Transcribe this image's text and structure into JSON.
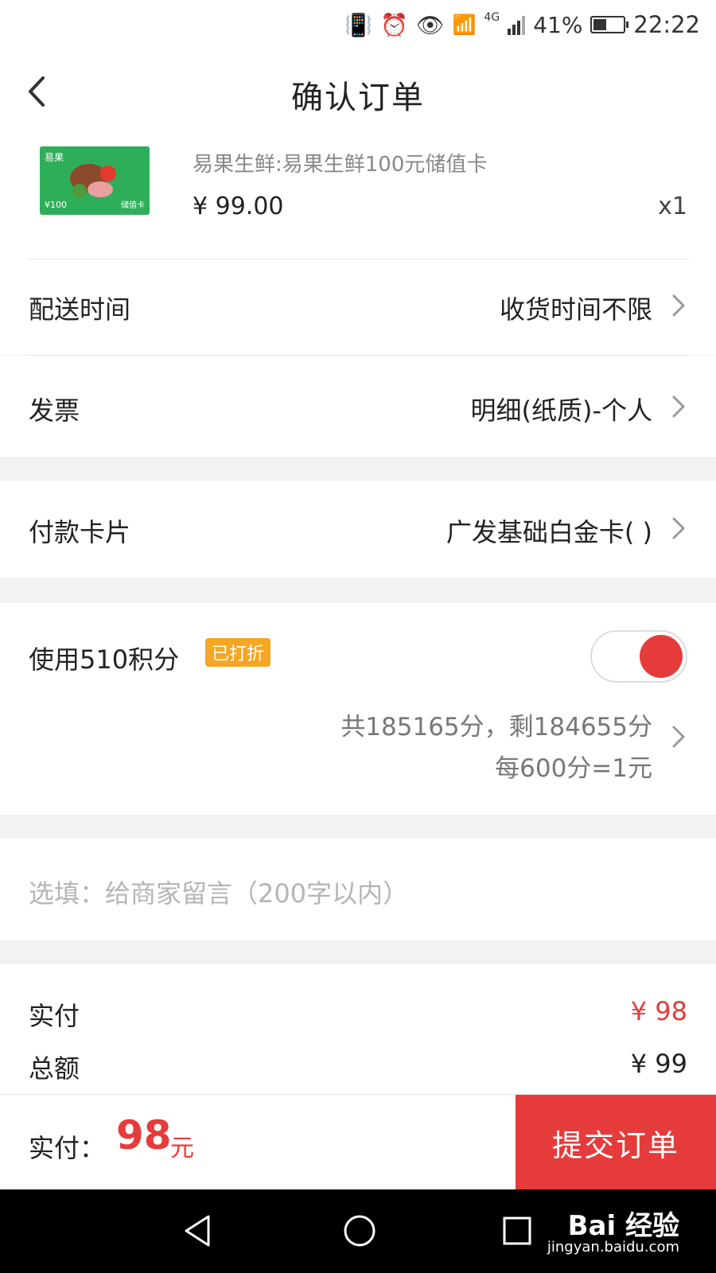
{
  "status_bar": {
    "battery": "41%",
    "network": "4G",
    "time": "22:22"
  },
  "header": {
    "title": "确认订单"
  },
  "product": {
    "thumb_brand": "易果",
    "thumb_amount": "¥100",
    "thumb_kind": "储值卡",
    "name": "易果生鲜:易果生鲜100元储值卡",
    "price": "¥ 99.00",
    "quantity": "x1"
  },
  "delivery": {
    "label": "配送时间",
    "value": "收货时间不限"
  },
  "invoice": {
    "label": "发票",
    "value": "明细(纸质)-个人"
  },
  "payment_card": {
    "label": "付款卡片",
    "value": "广发基础白金卡(      )"
  },
  "points": {
    "label": "使用510积分",
    "badge": "已打折",
    "enabled": true,
    "summary": "共185165分，剩184655分",
    "rate": "每600分=1元"
  },
  "note": {
    "placeholder": "选填：给商家留言（200字以内）"
  },
  "totals": {
    "paid_label": "实付",
    "paid_value": "¥ 98",
    "total_label": "总额",
    "total_value": "¥ 99"
  },
  "bottom_bar": {
    "pay_label": "实付：",
    "pay_amount": "98",
    "pay_unit": "元",
    "submit_label": "提交订单"
  },
  "watermark": {
    "brand": "Bai 经验",
    "url": "jingyan.baidu.com"
  },
  "colors": {
    "accent": "#e63b3b",
    "badge": "#f5a623",
    "card_green": "#2fae5a"
  }
}
